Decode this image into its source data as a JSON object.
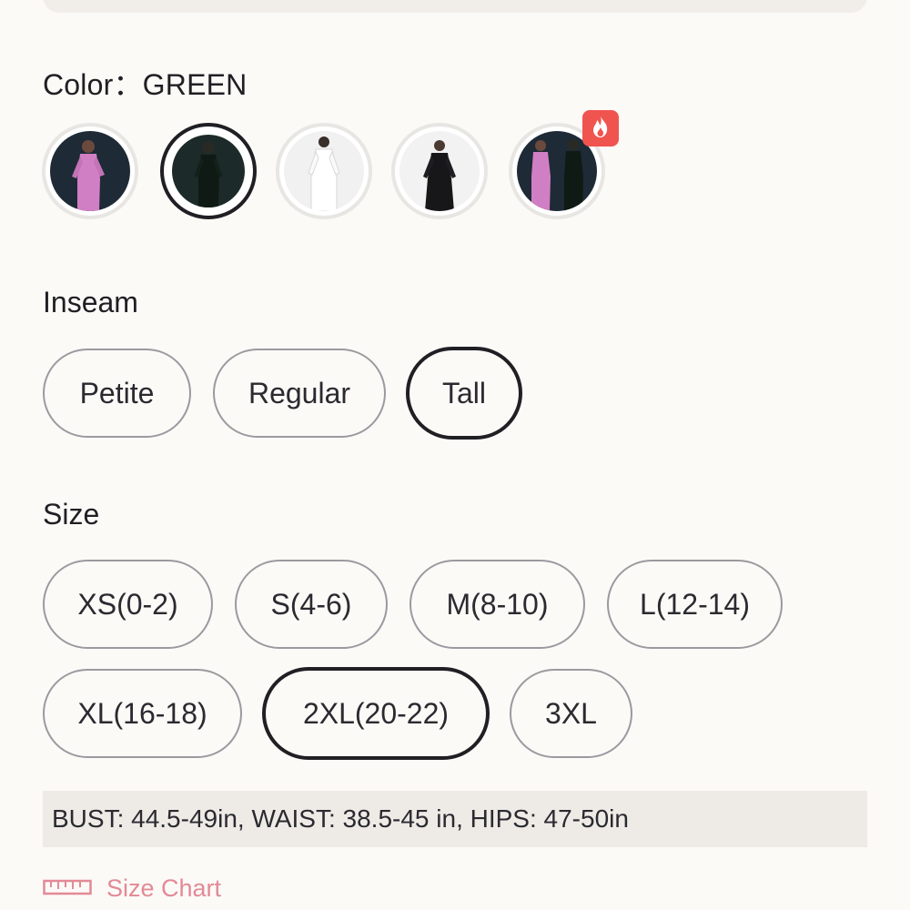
{
  "color": {
    "label": "Color：",
    "value": "GREEN",
    "swatches": [
      {
        "name": "pink",
        "selected": false
      },
      {
        "name": "green",
        "selected": true
      },
      {
        "name": "white",
        "selected": false
      },
      {
        "name": "black",
        "selected": false
      },
      {
        "name": "pink-green-combo",
        "selected": false,
        "badge": "fire-icon"
      }
    ]
  },
  "inseam": {
    "title": "Inseam",
    "options": [
      "Petite",
      "Regular",
      "Tall"
    ],
    "selected": "Tall"
  },
  "size": {
    "title": "Size",
    "options": [
      "XS(0-2)",
      "S(4-6)",
      "M(8-10)",
      "L(12-14)",
      "XL(16-18)",
      "2XL(20-22)",
      "3XL"
    ],
    "selected": "2XL(20-22)"
  },
  "measurements": "BUST: 44.5-49in, WAIST: 38.5-45 in, HIPS: 47-50in",
  "size_chart": {
    "label": "Size Chart",
    "icon": "ruler-icon"
  },
  "colors": {
    "accent": "#1f1f24",
    "badge": "#f0544f",
    "size_chart_link": "#e28a96"
  }
}
